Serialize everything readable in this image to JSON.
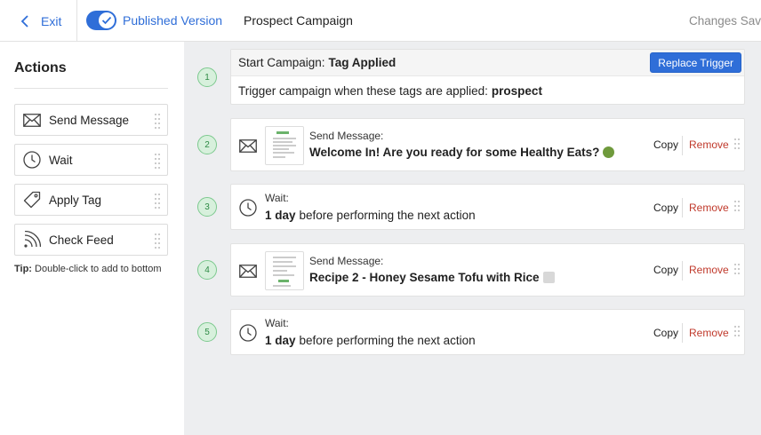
{
  "header": {
    "exit_label": "Exit",
    "toggle_label": "Published Version",
    "toggle_on": true,
    "campaign_title": "Prospect Campaign",
    "status_text": "Changes Saved"
  },
  "sidebar": {
    "title": "Actions",
    "items": [
      {
        "label": "Send Message",
        "icon": "envelope-icon"
      },
      {
        "label": "Wait",
        "icon": "clock-icon"
      },
      {
        "label": "Apply Tag",
        "icon": "tag-icon"
      },
      {
        "label": "Check Feed",
        "icon": "rss-icon"
      }
    ],
    "tip_bold": "Tip:",
    "tip_text": "Double-click to add to bottom"
  },
  "steps": {
    "s1": {
      "number": "1",
      "head_prefix": "Start Campaign:",
      "head_value": "Tag Applied",
      "button": "Replace Trigger",
      "body_prefix": "Trigger campaign when these tags are applied:",
      "body_value": "prospect"
    },
    "s2": {
      "number": "2",
      "kind": "Send Message:",
      "title": "Welcome In! Are you ready for some Healthy Eats?",
      "emoji": "🥗",
      "copy": "Copy",
      "remove": "Remove"
    },
    "s3": {
      "number": "3",
      "kind": "Wait:",
      "amount": "1 day",
      "rest": "before performing the next action",
      "copy": "Copy",
      "remove": "Remove"
    },
    "s4": {
      "number": "4",
      "kind": "Send Message:",
      "title": "Recipe 2 - Honey Sesame Tofu with Rice",
      "emoji": "🍽️",
      "copy": "Copy",
      "remove": "Remove"
    },
    "s5": {
      "number": "5",
      "kind": "Wait:",
      "amount": "1 day",
      "rest": "before performing the next action",
      "copy": "Copy",
      "remove": "Remove"
    }
  },
  "colors": {
    "accent": "#2f6ed8",
    "remove": "#c0392b",
    "step_badge_bg": "#d7f0dc",
    "step_badge_border": "#7cc98e",
    "canvas_bg": "#edeef0"
  }
}
